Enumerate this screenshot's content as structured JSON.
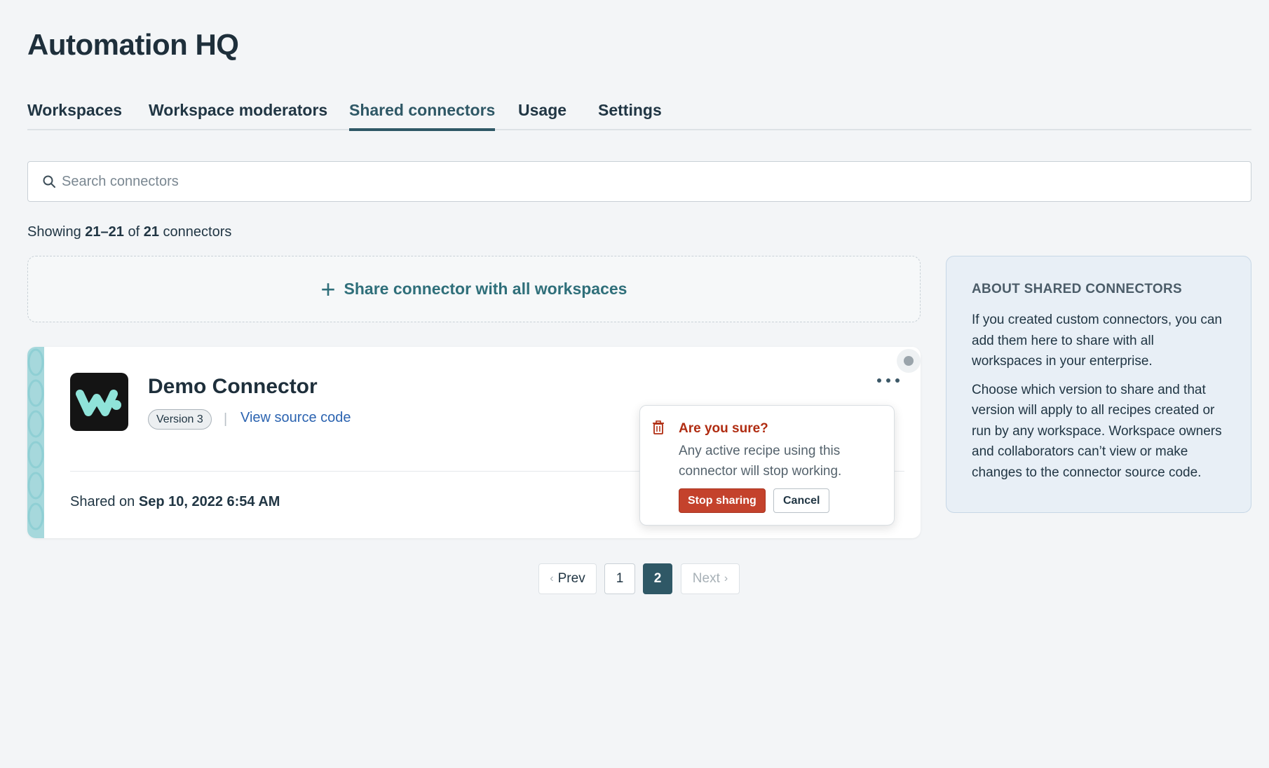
{
  "app_title": "Automation HQ",
  "tabs": [
    {
      "label": "Workspaces",
      "active": false
    },
    {
      "label": "Workspace moderators",
      "active": false
    },
    {
      "label": "Shared connectors",
      "active": true
    },
    {
      "label": "Usage",
      "active": false
    },
    {
      "label": "Settings",
      "active": false
    }
  ],
  "search": {
    "placeholder": "Search connectors",
    "value": ""
  },
  "showing": {
    "prefix": "Showing",
    "range": "21–21",
    "of": "of",
    "total": "21",
    "suffix": "connectors"
  },
  "share_button": {
    "label": "Share connector with all workspaces"
  },
  "connector": {
    "name": "Demo Connector",
    "version": "Version 3",
    "separator": "|",
    "view_source": "View source code",
    "shared_prefix": "Shared on",
    "shared_date": "Sep 10, 2022 6:54 AM"
  },
  "confirm": {
    "title": "Are you sure?",
    "message": "Any active recipe using this connector will stop working.",
    "stop_label": "Stop sharing",
    "cancel_label": "Cancel"
  },
  "about": {
    "heading": "ABOUT SHARED CONNECTORS",
    "para1": "If you created custom connectors, you can add them here to share with all workspaces in your enterprise.",
    "para2": "Choose which version to share and that version will apply to all recipes created or run by any workspace. Workspace owners and collaborators can’t view or make changes to the connector source code."
  },
  "pagination": {
    "prev": "Prev",
    "pages": [
      "1",
      "2"
    ],
    "current": "2",
    "next": "Next"
  },
  "colors": {
    "accent": "#2f5866",
    "danger": "#c4422c",
    "link": "#2b63b0",
    "logo_mark": "#8fe3d9"
  }
}
